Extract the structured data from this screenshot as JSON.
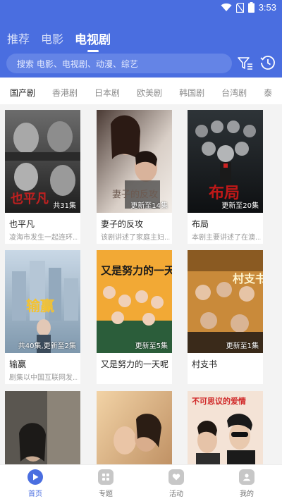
{
  "status_bar": {
    "time": "3:53"
  },
  "header": {
    "tabs": [
      {
        "label": "推荐",
        "active": false
      },
      {
        "label": "电影",
        "active": false
      },
      {
        "label": "电视剧",
        "active": true
      }
    ],
    "search": {
      "placeholder": "搜索 电影、电视剧、动漫、综艺"
    }
  },
  "categories": [
    {
      "label": "国产剧",
      "active": true
    },
    {
      "label": "香港剧",
      "active": false
    },
    {
      "label": "日本剧",
      "active": false
    },
    {
      "label": "欧美剧",
      "active": false
    },
    {
      "label": "韩国剧",
      "active": false
    },
    {
      "label": "台湾剧",
      "active": false
    },
    {
      "label": "泰",
      "active": false
    }
  ],
  "cards": [
    {
      "title": "也平凡",
      "desc": "凌海市发生一起连环…",
      "badge": "共31集",
      "poster_text": "也平凡"
    },
    {
      "title": "妻子的反攻",
      "desc": "该剧讲述了家庭主妇…",
      "badge": "更新至14集",
      "poster_text": "妻子的反攻"
    },
    {
      "title": "布局",
      "desc": "本剧主要讲述了在澳…",
      "badge": "更新至20集",
      "poster_text": "布局"
    },
    {
      "title": "输赢",
      "desc": "剧集以中国互联网发…",
      "badge": "共40集,更新至2集",
      "poster_text": "输赢"
    },
    {
      "title": "又是努力的一天呢",
      "desc": "",
      "badge": "更新至5集",
      "poster_text": "又是努力的一天呢"
    },
    {
      "title": "村支书",
      "desc": "",
      "badge": "更新至1集",
      "poster_text": "村支书"
    },
    {
      "title": "",
      "desc": "",
      "badge": "",
      "poster_text": ""
    },
    {
      "title": "",
      "desc": "",
      "badge": "",
      "poster_text": ""
    },
    {
      "title": "",
      "desc": "",
      "badge": "",
      "poster_text": "不可思议的爱情"
    }
  ],
  "bottom_nav": [
    {
      "label": "首页",
      "icon": "play-icon",
      "active": true
    },
    {
      "label": "专题",
      "icon": "grid-icon",
      "active": false
    },
    {
      "label": "活动",
      "icon": "heart-icon",
      "active": false
    },
    {
      "label": "我的",
      "icon": "user-icon",
      "active": false
    }
  ],
  "colors": {
    "primary": "#4a6ee0",
    "background": "#f3f3f3"
  }
}
